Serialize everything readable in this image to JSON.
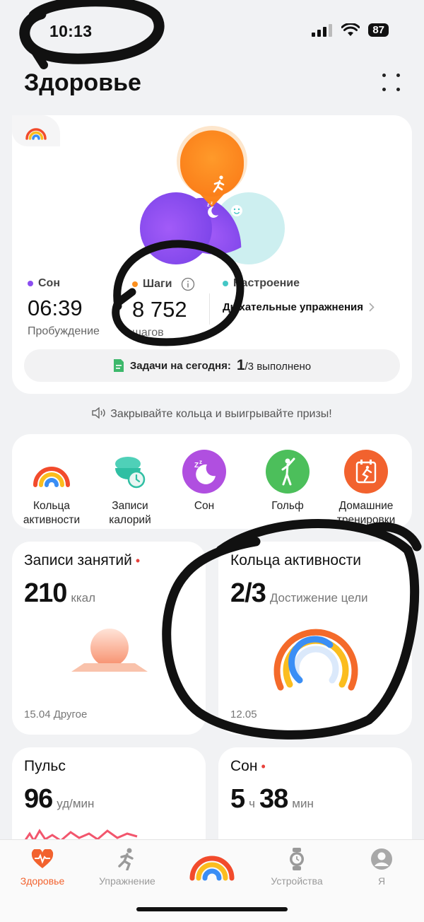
{
  "status_bar": {
    "time": "10:13",
    "battery": "87"
  },
  "header": {
    "title": "Здоровье"
  },
  "summary": {
    "sleep": {
      "label": "Сон",
      "value": "06:39",
      "sub": "Пробуждение"
    },
    "steps": {
      "label": "Шаги",
      "value": "8 752",
      "sub": "шагов"
    },
    "mood": {
      "label": "Настроение",
      "link": "Дыхательные упражнения"
    },
    "tasks": {
      "prefix": "Задачи на сегодня:",
      "done": "1",
      "suffix": "/3 выполнено"
    }
  },
  "promo": "Закрывайте кольца и выигрывайте призы!",
  "shortcuts": [
    {
      "label": "Кольца активности",
      "icon": "activity-rings-icon"
    },
    {
      "label": "Записи калорий",
      "icon": "calorie-bowl-icon"
    },
    {
      "label": "Сон",
      "icon": "sleep-moon-icon"
    },
    {
      "label": "Гольф",
      "icon": "golf-icon"
    },
    {
      "label": "Домашние тренировки",
      "icon": "home-workout-icon"
    }
  ],
  "tiles": {
    "workouts": {
      "title": "Записи занятий",
      "value": "210",
      "unit": "ккал",
      "footer": "15.04 Другое"
    },
    "rings": {
      "title": "Кольца активности",
      "value": "2/3",
      "unit": "Достижение цели",
      "footer": "12.05"
    },
    "pulse": {
      "title": "Пульс",
      "value": "96",
      "unit": "уд/мин"
    },
    "sleep": {
      "title": "Сон",
      "hours": "5",
      "h_unit": "ч",
      "minutes": "38",
      "m_unit": "мин"
    }
  },
  "nav": {
    "health": "Здоровье",
    "exercise": "Упражнение",
    "devices": "Устройства",
    "me": "Я"
  },
  "colors": {
    "accent": "#f2622e",
    "steps": "#fb8f1e",
    "sleep": "#8b4ef0",
    "mood": "#45c7c6",
    "red_dot": "#e8413b"
  }
}
